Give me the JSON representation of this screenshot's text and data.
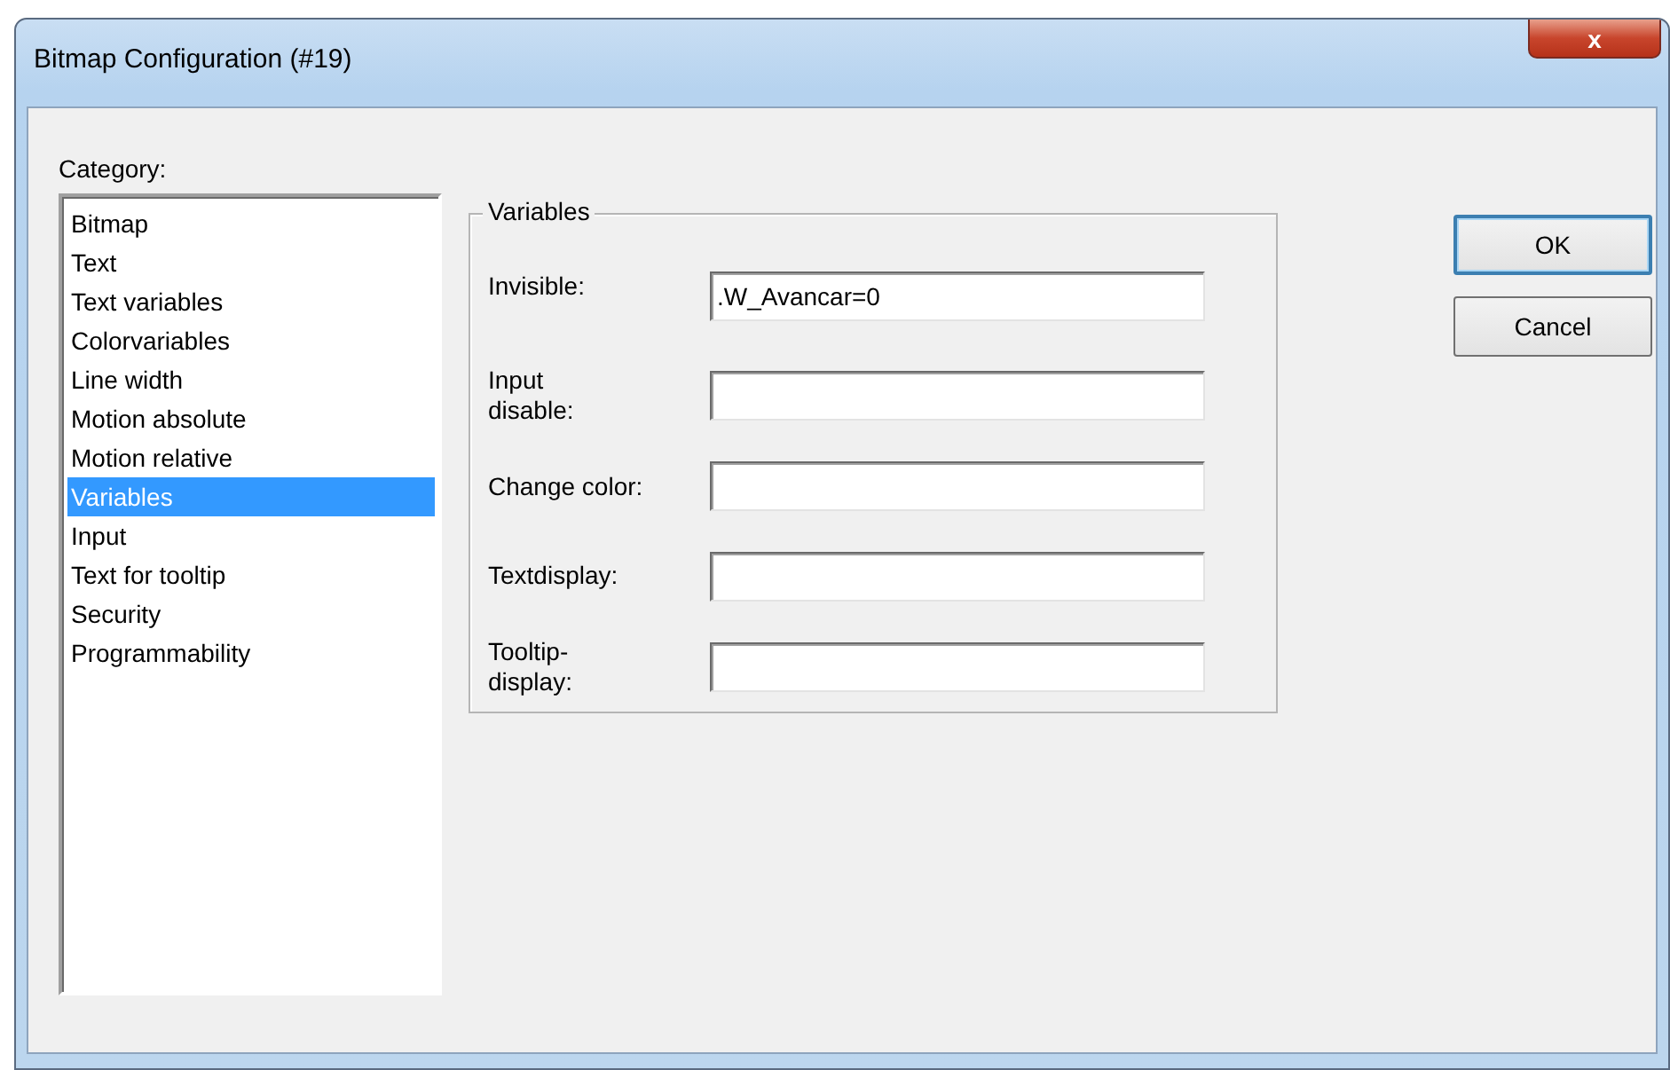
{
  "window": {
    "title": "Bitmap Configuration (#19)",
    "close": "x"
  },
  "category": {
    "label": "Category:",
    "items": [
      {
        "label": "Bitmap",
        "selected": false
      },
      {
        "label": "Text",
        "selected": false
      },
      {
        "label": "Text variables",
        "selected": false
      },
      {
        "label": "Colorvariables",
        "selected": false
      },
      {
        "label": "Line width",
        "selected": false
      },
      {
        "label": "Motion absolute",
        "selected": false
      },
      {
        "label": "Motion relative",
        "selected": false
      },
      {
        "label": "Variables",
        "selected": true
      },
      {
        "label": "Input",
        "selected": false
      },
      {
        "label": "Text for tooltip",
        "selected": false
      },
      {
        "label": "Security",
        "selected": false
      },
      {
        "label": "Programmability",
        "selected": false
      }
    ]
  },
  "group": {
    "title": "Variables",
    "fields": [
      {
        "label": "Invisible:",
        "kind": "one-line",
        "value": ".W_Avancar=0"
      },
      {
        "label": "Input disable:",
        "kind": "two-line"
      },
      {
        "label": "Change color:",
        "kind": "one-line"
      },
      {
        "label": "Textdisplay:",
        "kind": "one-line"
      },
      {
        "label": "Tooltip-display:",
        "kind": "two-line"
      }
    ]
  },
  "buttons": [
    {
      "label": "OK",
      "default": true
    },
    {
      "label": "Cancel",
      "default": false
    }
  ]
}
